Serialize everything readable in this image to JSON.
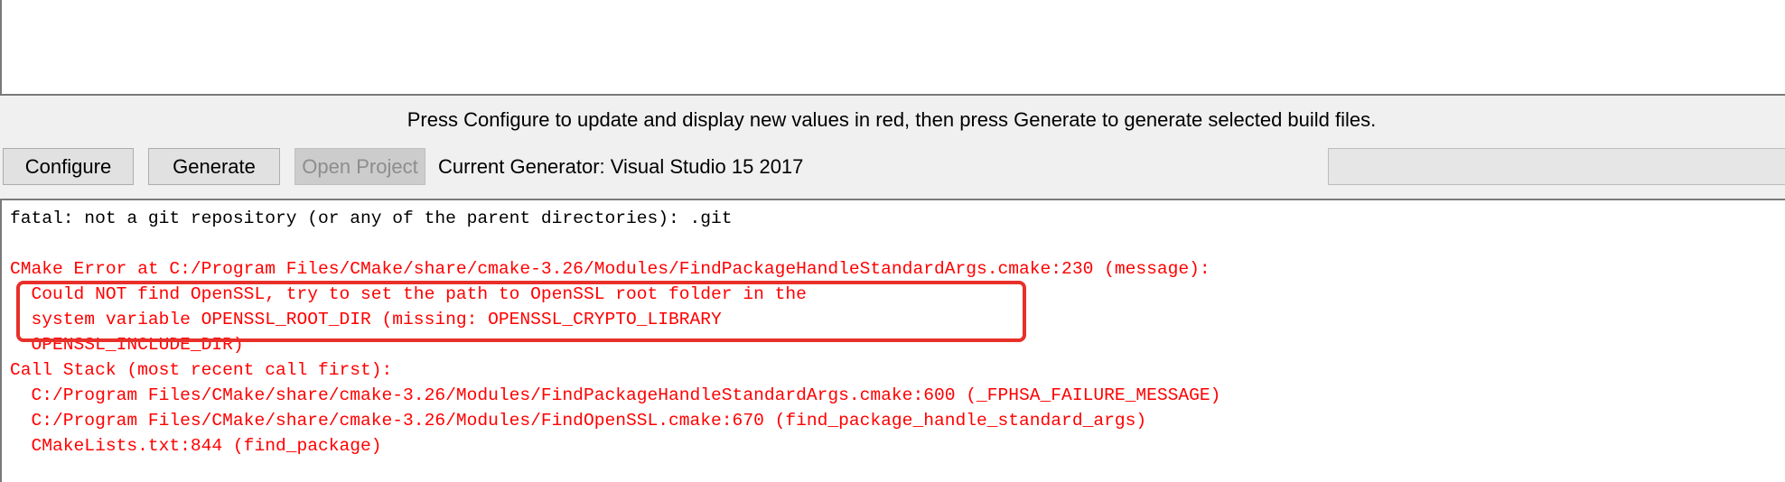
{
  "hint": "Press Configure to update and display new values in red, then press Generate to generate selected build files.",
  "buttons": {
    "configure": "Configure",
    "generate": "Generate",
    "open_project": "Open Project"
  },
  "generator": "Current Generator: Visual Studio 15 2017",
  "output": {
    "lines": [
      {
        "text": "fatal: not a git repository (or any of the parent directories): .git",
        "color": "black"
      },
      {
        "text": "",
        "color": "black"
      },
      {
        "text": "CMake Error at C:/Program Files/CMake/share/cmake-3.26/Modules/FindPackageHandleStandardArgs.cmake:230 (message):",
        "color": "red"
      },
      {
        "text": "  Could NOT find OpenSSL, try to set the path to OpenSSL root folder in the",
        "color": "red"
      },
      {
        "text": "  system variable OPENSSL_ROOT_DIR (missing: OPENSSL_CRYPTO_LIBRARY",
        "color": "red"
      },
      {
        "text": "  OPENSSL_INCLUDE_DIR)",
        "color": "red"
      },
      {
        "text": "Call Stack (most recent call first):",
        "color": "red"
      },
      {
        "text": "  C:/Program Files/CMake/share/cmake-3.26/Modules/FindPackageHandleStandardArgs.cmake:600 (_FPHSA_FAILURE_MESSAGE)",
        "color": "red"
      },
      {
        "text": "  C:/Program Files/CMake/share/cmake-3.26/Modules/FindOpenSSL.cmake:670 (find_package_handle_standard_args)",
        "color": "red"
      },
      {
        "text": "  CMakeLists.txt:844 (find_package)",
        "color": "red"
      }
    ]
  },
  "colors": {
    "error_text": "#ff0000",
    "normal_text": "#000000",
    "highlight_box": "#e8302a"
  }
}
